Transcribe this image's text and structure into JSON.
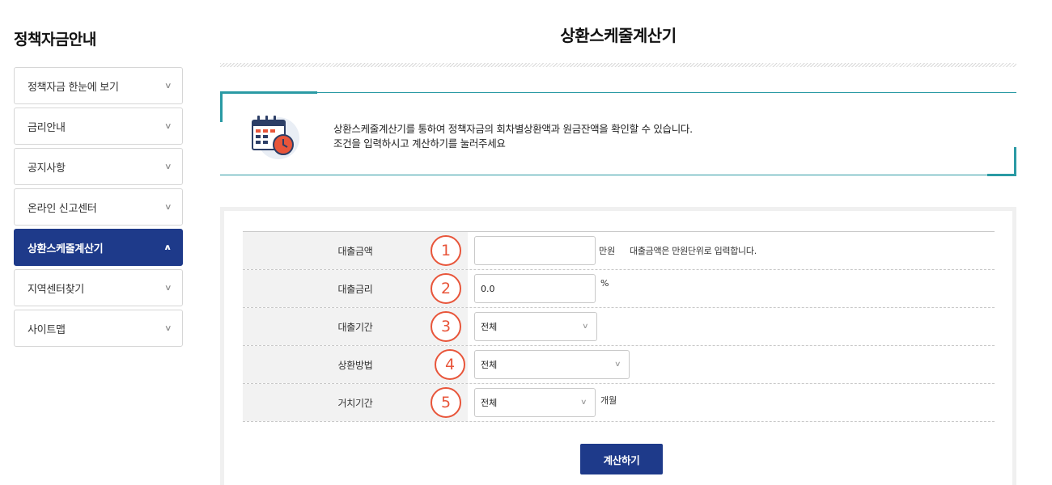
{
  "sidebar": {
    "title": "정책자금안내",
    "items": [
      {
        "label": "정책자금 한눈에 보기",
        "active": false
      },
      {
        "label": "금리안내",
        "active": false
      },
      {
        "label": "공지사항",
        "active": false
      },
      {
        "label": "온라인 신고센터",
        "active": false
      },
      {
        "label": "상환스케줄계산기",
        "active": true
      },
      {
        "label": "지역센터찾기",
        "active": false
      },
      {
        "label": "사이트맵",
        "active": false
      }
    ]
  },
  "main": {
    "title": "상환스케줄계산기",
    "info": {
      "line1": "상환스케줄계산기를 통하여 정책자금의 회차별상환액과 원금잔액을 확인할 수 있습니다.",
      "line2": "조건을 입력하시고 계산하기를 눌러주세요",
      "icon": "calendar-clock-icon"
    },
    "form": {
      "rows": [
        {
          "num": "1",
          "label": "대출금액",
          "value": "",
          "unit": "만원",
          "hint": "대출금액은 만원단위로 입력합니다."
        },
        {
          "num": "2",
          "label": "대출금리",
          "value": "0.0",
          "unit": "%"
        },
        {
          "num": "3",
          "label": "대출기간",
          "value": "전체"
        },
        {
          "num": "4",
          "label": "상환방법",
          "value": "전체"
        },
        {
          "num": "5",
          "label": "거치기간",
          "value": "전체",
          "unit": "개월"
        }
      ],
      "submit_label": "계산하기"
    }
  },
  "colors": {
    "primary": "#1e3a8a",
    "accent_teal": "#2a9aa4",
    "marker": "#e8553a"
  }
}
